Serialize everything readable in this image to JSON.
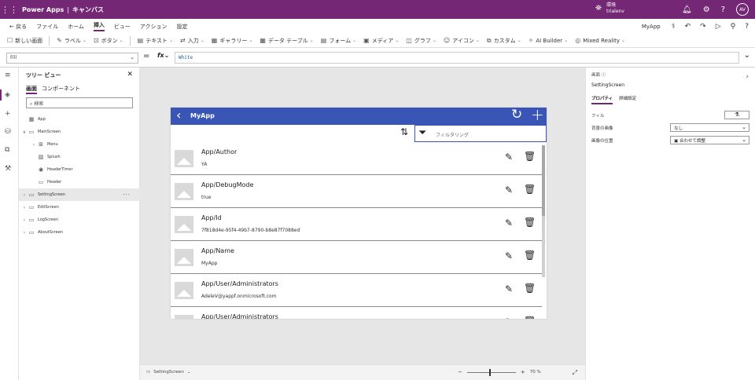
{
  "topbar": {
    "brand": "Power Apps",
    "separator": "|",
    "context": "キャンバス",
    "env_label": "環境",
    "env_name": "trialenv",
    "avatar": "AV",
    "bg_color": "#742774"
  },
  "menu": {
    "items": [
      "戻る",
      "ファイル",
      "ホーム",
      "挿入",
      "ビュー",
      "アクション",
      "設定"
    ],
    "active": "挿入",
    "app_name": "MyApp"
  },
  "ribbon": {
    "items": [
      {
        "icon": "new-screen-icon",
        "label": "新しい画面"
      },
      {
        "icon": "label-icon",
        "label": "ラベル"
      },
      {
        "icon": "button-icon",
        "label": "ボタン"
      },
      {
        "icon": "text-icon",
        "label": "テキスト"
      },
      {
        "icon": "input-icon",
        "label": "入力"
      },
      {
        "icon": "gallery-icon",
        "label": "ギャラリー"
      },
      {
        "icon": "datatable-icon",
        "label": "データ テーブル"
      },
      {
        "icon": "form-icon",
        "label": "フォーム"
      },
      {
        "icon": "media-icon",
        "label": "メディア"
      },
      {
        "icon": "chart-icon",
        "label": "グラフ"
      },
      {
        "icon": "icons-icon",
        "label": "アイコン"
      },
      {
        "icon": "custom-icon",
        "label": "カスタム"
      },
      {
        "icon": "ai-builder-icon",
        "label": "AI Builder"
      },
      {
        "icon": "mixed-reality-icon",
        "label": "Mixed Reality"
      }
    ]
  },
  "formula": {
    "property": "Fill",
    "value": "White"
  },
  "tree": {
    "title": "ツリー ビュー",
    "tabs": [
      "画面",
      "コンポーネント"
    ],
    "search_placeholder": "検索",
    "nodes": [
      {
        "label": "App",
        "level": 0,
        "icon": "app-icon",
        "chev": ""
      },
      {
        "label": "MainScreen",
        "level": 0,
        "icon": "screen-icon",
        "chev": "∨"
      },
      {
        "label": "Menu",
        "level": 1,
        "icon": "group-icon",
        "chev": "›"
      },
      {
        "label": "Splush",
        "level": 1,
        "icon": "image-icon",
        "chev": ""
      },
      {
        "label": "HeaderTimer",
        "level": 1,
        "icon": "timer-icon",
        "chev": ""
      },
      {
        "label": "Header",
        "level": 1,
        "icon": "rectangle-icon",
        "chev": ""
      },
      {
        "label": "SettingScreen",
        "level": 0,
        "icon": "screen-icon",
        "chev": "›",
        "selected": true
      },
      {
        "label": "EditScreen",
        "level": 0,
        "icon": "screen-icon",
        "chev": "›"
      },
      {
        "label": "LogScreen",
        "level": 0,
        "icon": "screen-icon",
        "chev": "›"
      },
      {
        "label": "AboutScreen",
        "level": 0,
        "icon": "screen-icon",
        "chev": "›"
      }
    ]
  },
  "app": {
    "title": "MyApp",
    "filter_placeholder": "フィルタリング",
    "items": [
      {
        "title": "App/Author",
        "subtitle": "YA"
      },
      {
        "title": "App/DebugMode",
        "subtitle": "true"
      },
      {
        "title": "App/Id",
        "subtitle": "7f818d4e-95f4-49b7-8790-b8e87f7088ed"
      },
      {
        "title": "App/Name",
        "subtitle": "MyApp"
      },
      {
        "title": "App/User/Administrators",
        "subtitle": "AdeleV@yappf.onmicrosoft.com"
      },
      {
        "title": "App/User/Administrators",
        "subtitle": ""
      }
    ],
    "header_color": "#3955b6"
  },
  "bottom": {
    "screen_name": "SettingScreen",
    "zoom": "70 %"
  },
  "props": {
    "type_label": "画面",
    "screen_name": "SettingScreen",
    "tabs": [
      "プロパティ",
      "詳細設定"
    ],
    "fill_label": "フィル",
    "bg_image_label": "背景の画像",
    "bg_image_value": "なし",
    "image_position_label": "画像の位置",
    "image_position_value": "合わせて調整"
  }
}
